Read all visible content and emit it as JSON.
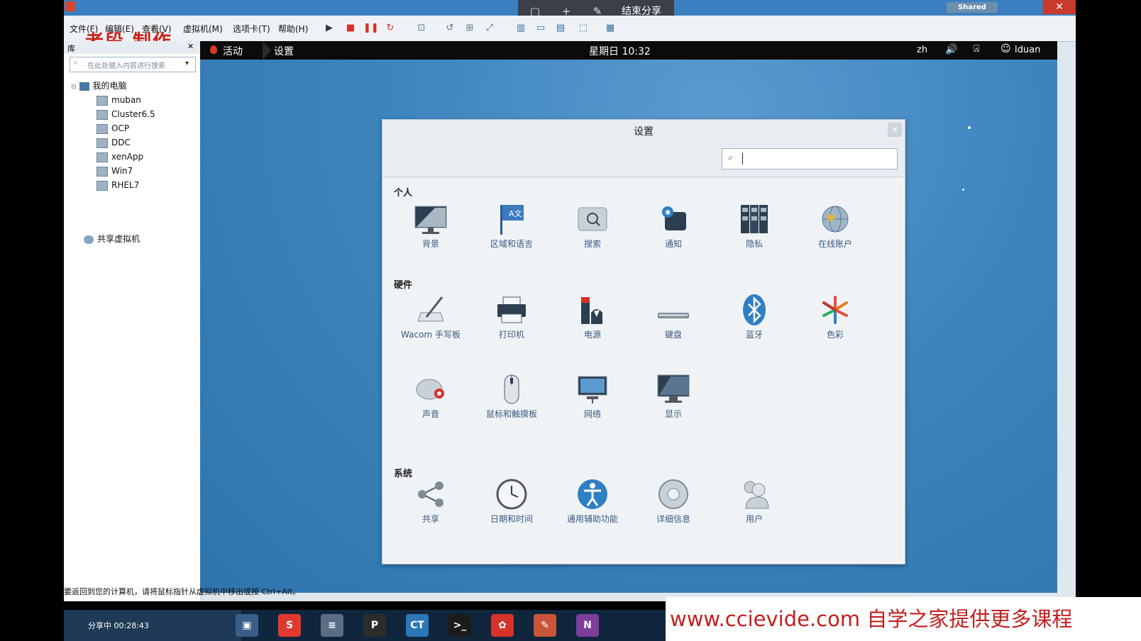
{
  "host": {
    "shared_label": "Shared",
    "close_glyph": "✕",
    "share_bar": {
      "end_label": "结束分享",
      "icons": [
        "screen-icon",
        "pointer-icon",
        "pen-icon"
      ]
    },
    "author_watermark": "老段 制作",
    "menus": [
      "文件(F)",
      "编辑(E)",
      "查看(V)",
      "虚拟机(M)",
      "选项卡(T)",
      "帮助(H)"
    ],
    "toolbar_icons": [
      "play-icon",
      "stop-icon",
      "suspend-icon",
      "reset-icon",
      "snapshot-icon",
      "revert-icon",
      "manage-snapshots-icon",
      "fullscreen-icon",
      "unity-icon",
      "console-view-icon",
      "thumbnail-icon",
      "stretch-icon",
      "library-icon"
    ]
  },
  "library": {
    "title": "库",
    "close_glyph": "✕",
    "search_placeholder": "在此处键入内容进行搜索",
    "root": "我的电脑",
    "vms": [
      "muban",
      "Cluster6.5",
      "OCP",
      "DDC",
      "xenApp",
      "Win7",
      "RHEL7"
    ],
    "shared": "共享虚拟机"
  },
  "guest": {
    "activities": "活动",
    "app_name": "设置",
    "clock": "星期日 10:32",
    "lang": "zh",
    "volume_icon": "volume-icon",
    "network_icon": "network-icon",
    "user": "lduan"
  },
  "settings": {
    "title": "设置",
    "search_value": "",
    "sections": [
      {
        "label": "个人",
        "items": [
          {
            "label": "背景",
            "icon": "background-icon"
          },
          {
            "label": "区域和语言",
            "icon": "region-language-icon"
          },
          {
            "label": "搜索",
            "icon": "search-settings-icon"
          },
          {
            "label": "通知",
            "icon": "notifications-icon"
          },
          {
            "label": "隐私",
            "icon": "privacy-icon"
          },
          {
            "label": "在线账户",
            "icon": "online-accounts-icon"
          }
        ]
      },
      {
        "label": "硬件",
        "items": [
          {
            "label": "Wacom 手写板",
            "icon": "wacom-tablet-icon"
          },
          {
            "label": "打印机",
            "icon": "printer-icon"
          },
          {
            "label": "电源",
            "icon": "power-icon"
          },
          {
            "label": "键盘",
            "icon": "keyboard-icon"
          },
          {
            "label": "蓝牙",
            "icon": "bluetooth-icon"
          },
          {
            "label": "色彩",
            "icon": "color-icon"
          },
          {
            "label": "声音",
            "icon": "sound-icon"
          },
          {
            "label": "鼠标和触摸板",
            "icon": "mouse-touchpad-icon"
          },
          {
            "label": "网络",
            "icon": "network-settings-icon"
          },
          {
            "label": "显示",
            "icon": "display-icon"
          }
        ]
      },
      {
        "label": "系统",
        "items": [
          {
            "label": "共享",
            "icon": "sharing-icon"
          },
          {
            "label": "日期和时间",
            "icon": "date-time-icon"
          },
          {
            "label": "通用辅助功能",
            "icon": "accessibility-icon"
          },
          {
            "label": "详细信息",
            "icon": "details-icon"
          },
          {
            "label": "用户",
            "icon": "users-icon"
          }
        ]
      }
    ]
  },
  "status_bar": "要返回到您的计算机，请将鼠标指针从虚拟机中移出或按 Ctrl+Alt。",
  "taskbar": {
    "share_status": "分享中 00:28:43",
    "apps": [
      {
        "icon": "vmware-icon",
        "color": "#3b5d8a",
        "glyph": "▣"
      },
      {
        "icon": "sogou-icon",
        "color": "#e03a2f",
        "glyph": "S"
      },
      {
        "icon": "database-icon",
        "color": "#5a6f86",
        "glyph": "≡"
      },
      {
        "icon": "putty-icon",
        "color": "#2c2c2c",
        "glyph": "P"
      },
      {
        "icon": "ct-icon",
        "color": "#2a78b8",
        "glyph": "CT"
      },
      {
        "icon": "cmd-icon",
        "color": "#1b1b1b",
        "glyph": ">_"
      },
      {
        "icon": "huawei-icon",
        "color": "#d6332b",
        "glyph": "✿"
      },
      {
        "icon": "paint-icon",
        "color": "#c9553a",
        "glyph": "✎"
      },
      {
        "icon": "onenote-icon",
        "color": "#7b3d9a",
        "glyph": "N"
      }
    ]
  },
  "promo_watermark": "www.ccievide.com  自学之家提供更多课程"
}
